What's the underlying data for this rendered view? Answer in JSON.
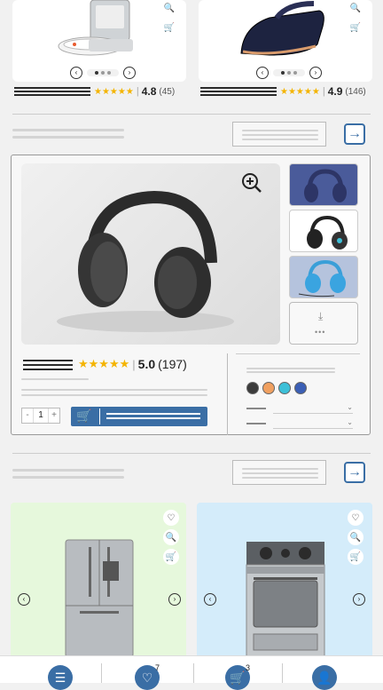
{
  "top_products": [
    {
      "name": "robot-vacuum",
      "rating": "4.8",
      "review_count": "(45)",
      "stars": "★★★★★"
    },
    {
      "name": "steam-iron",
      "rating": "4.9",
      "review_count": "(146)",
      "stars": "★★★★★"
    }
  ],
  "featured": {
    "rating": "5.0",
    "review_count": "(197)",
    "stars": "★★★★★",
    "quantity": "1",
    "qty_minus": "-",
    "qty_plus": "+",
    "more_dots": "•••",
    "swatches": [
      "#3b3b3b",
      "#f0a060",
      "#3cc0d8",
      "#3b5fb5"
    ]
  },
  "bottom_products": [
    {
      "name": "refrigerator",
      "bg": "#e6f8dc"
    },
    {
      "name": "gas-range",
      "bg": "#d4ecfa"
    }
  ],
  "nav": {
    "wishlist_count": "7",
    "cart_count": "3"
  },
  "colors": {
    "accent": "#3a6ea5",
    "star": "#f4b400"
  }
}
